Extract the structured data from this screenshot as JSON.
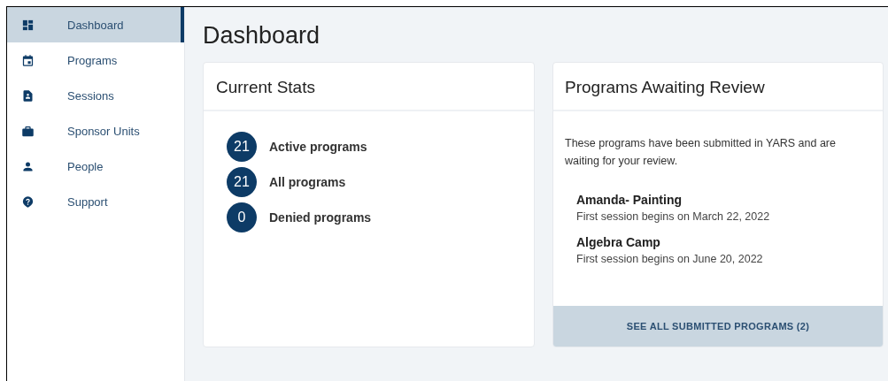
{
  "sidebar": {
    "items": [
      {
        "label": "Dashboard",
        "selected": true
      },
      {
        "label": "Programs",
        "selected": false
      },
      {
        "label": "Sessions",
        "selected": false
      },
      {
        "label": "Sponsor Units",
        "selected": false
      },
      {
        "label": "People",
        "selected": false
      },
      {
        "label": "Support",
        "selected": false
      }
    ]
  },
  "page_title": "Dashboard",
  "current_stats": {
    "title": "Current Stats",
    "stats": [
      {
        "count": "21",
        "label": "Active programs"
      },
      {
        "count": "21",
        "label": "All programs"
      },
      {
        "count": "0",
        "label": "Denied programs"
      }
    ]
  },
  "review": {
    "title": "Programs Awaiting Review",
    "description": "These programs have been submitted in YARS and are waiting for your review.",
    "programs": [
      {
        "name": "Amanda- Painting",
        "detail": "First session begins on March 22, 2022"
      },
      {
        "name": "Algebra Camp",
        "detail": "First session begins on June 20, 2022"
      }
    ],
    "button": "SEE ALL SUBMITTED PROGRAMS (2)"
  }
}
